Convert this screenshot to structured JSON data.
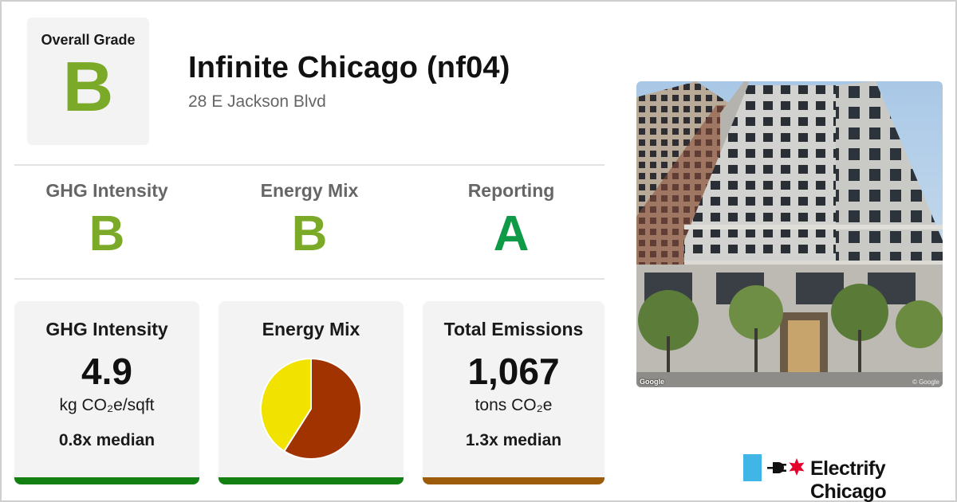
{
  "colors": {
    "grade_b": "#7ba928",
    "grade_a": "#0f9a48",
    "bar_green": "#128012",
    "bar_brown": "#9c5c0c",
    "pie_brown": "#a03300",
    "pie_yellow": "#f1e200",
    "brand_blue": "#41b6e6",
    "brand_red": "#e4002b"
  },
  "overall": {
    "label": "Overall Grade",
    "grade": "B"
  },
  "building": {
    "name": "Infinite Chicago (nf04)",
    "address": "28 E Jackson Blvd"
  },
  "subgrades": [
    {
      "label": "GHG Intensity",
      "grade": "B"
    },
    {
      "label": "Energy Mix",
      "grade": "B"
    },
    {
      "label": "Reporting",
      "grade": "A"
    }
  ],
  "cards": {
    "ghg": {
      "title": "GHG Intensity",
      "value": "4.9",
      "unit": "kg CO₂e/sqft",
      "median": "0.8x median"
    },
    "mix": {
      "title": "Energy Mix"
    },
    "emissions": {
      "title": "Total Emissions",
      "value": "1,067",
      "unit": "tons CO₂e",
      "median": "1.3x median"
    }
  },
  "chart_data": {
    "type": "pie",
    "slices": [
      {
        "color": "#a03300",
        "value": 0.59
      },
      {
        "color": "#f1e200",
        "value": 0.41
      }
    ]
  },
  "photo": {
    "credit": "Google",
    "copyright": "© Google",
    "icon": "building-street-view"
  },
  "brand": {
    "name": "Electrify Chicago",
    "icons": [
      "chicago-flag-icon",
      "plug-icon",
      "chicago-star-icon"
    ]
  }
}
